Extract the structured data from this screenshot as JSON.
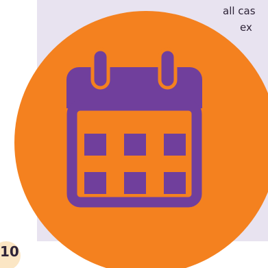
{
  "panel": {
    "line_1": "all cas",
    "line_2": "ex"
  },
  "icon": {
    "name": "calendar-icon",
    "color": "#703f9c",
    "background": "#f4811f"
  },
  "badge": {
    "text": "10"
  },
  "colors": {
    "panel_background": "#e8e3f0",
    "badge_background": "#fbe6c4",
    "text": "#2e2438"
  }
}
